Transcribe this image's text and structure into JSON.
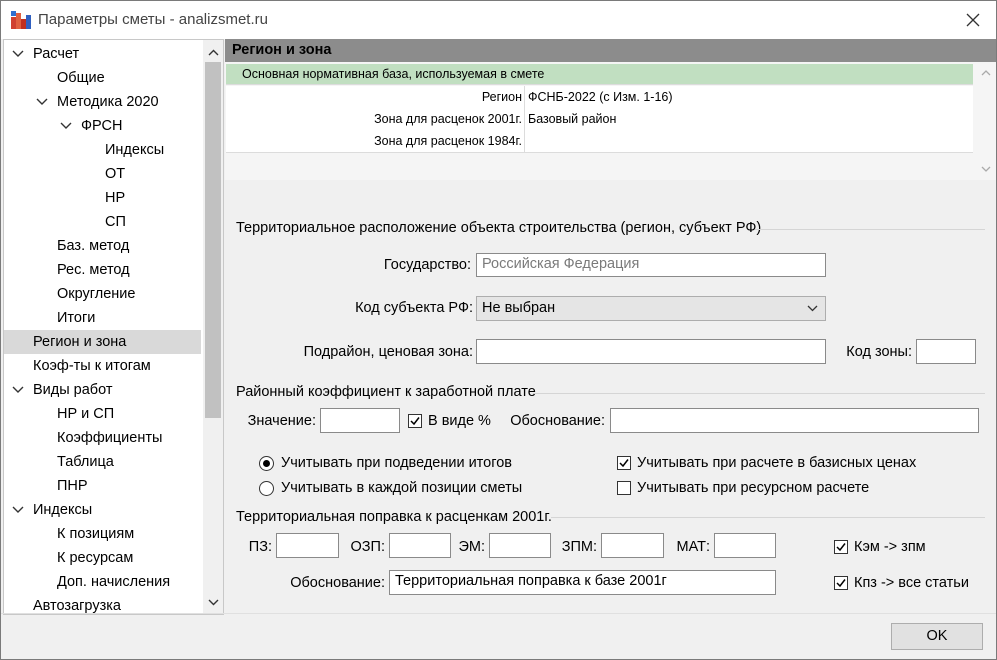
{
  "window": {
    "title": "Параметры сметы - analizsmet.ru"
  },
  "tree": {
    "items": [
      {
        "label": "Расчет"
      },
      {
        "label": "Общие"
      },
      {
        "label": "Методика 2020"
      },
      {
        "label": "ФРСН"
      },
      {
        "label": "Индексы"
      },
      {
        "label": "ОТ"
      },
      {
        "label": "НР"
      },
      {
        "label": "СП"
      },
      {
        "label": "Баз. метод"
      },
      {
        "label": "Рес. метод"
      },
      {
        "label": "Округление"
      },
      {
        "label": "Итоги"
      },
      {
        "label": "Регион и зона"
      },
      {
        "label": "Коэф-ты к итогам"
      },
      {
        "label": "Виды работ"
      },
      {
        "label": "НР и СП"
      },
      {
        "label": "Коэффициенты"
      },
      {
        "label": "Таблица"
      },
      {
        "label": "ПНР"
      },
      {
        "label": "Индексы"
      },
      {
        "label": "К позициям"
      },
      {
        "label": "К ресурсам"
      },
      {
        "label": "Доп. начисления"
      },
      {
        "label": "Автозагрузка"
      }
    ]
  },
  "panel": {
    "header": "Регион и зона",
    "grid": {
      "group": "Основная нормативная база, используемая в смете",
      "rows": [
        {
          "label": "Регион",
          "value": "ФСНБ-2022 (с Изм. 1-16)"
        },
        {
          "label": "Зона для расценок 2001г.",
          "value": "Базовый район"
        },
        {
          "label": "Зона для расценок 1984г.",
          "value": ""
        }
      ]
    }
  },
  "territory": {
    "title": "Территориальное расположение объекта строительства (регион, субъект РФ)",
    "country_label": "Государство:",
    "country_value": "Российская Федерация",
    "subject_label": "Код субъекта РФ:",
    "subject_value": "Не выбран",
    "subregion_label": "Подрайон, ценовая зона:",
    "subregion_value": "",
    "zone_code_label": "Код зоны:",
    "zone_code_value": ""
  },
  "district": {
    "title": "Районный коэффициент к заработной плате",
    "value_label": "Значение:",
    "value": "",
    "percent_label": "В виде %",
    "percent_checked": true,
    "basis_label": "Обоснование:",
    "basis_value": "",
    "radio1": "Учитывать при подведении итогов",
    "radio2": "Учитывать в каждой позиции сметы",
    "radio_selected": 1,
    "check_base_label": "Учитывать при расчете в базисных ценах",
    "check_base": true,
    "check_res_label": "Учитывать при ресурсном расчете",
    "check_res": false
  },
  "correction": {
    "title": "Территориальная поправка к расценкам 2001г.",
    "fields": [
      {
        "label": "ПЗ:",
        "value": ""
      },
      {
        "label": "ОЗП:",
        "value": ""
      },
      {
        "label": "ЭМ:",
        "value": ""
      },
      {
        "label": "ЗПМ:",
        "value": ""
      },
      {
        "label": "МАТ:",
        "value": ""
      }
    ],
    "kem_label": "Кэм -> зпм",
    "kem_checked": true,
    "kpz_label": "Кпз -> все статьи",
    "kpz_checked": true,
    "basis_label": "Обоснование:",
    "basis_value": "Территориальная поправка к базе 2001г"
  },
  "footer": {
    "ok": "OK"
  },
  "colors": {
    "accent_green": "#c1dfc1",
    "header_gray": "#8c8c8c",
    "selected": "#d9d9d9"
  }
}
